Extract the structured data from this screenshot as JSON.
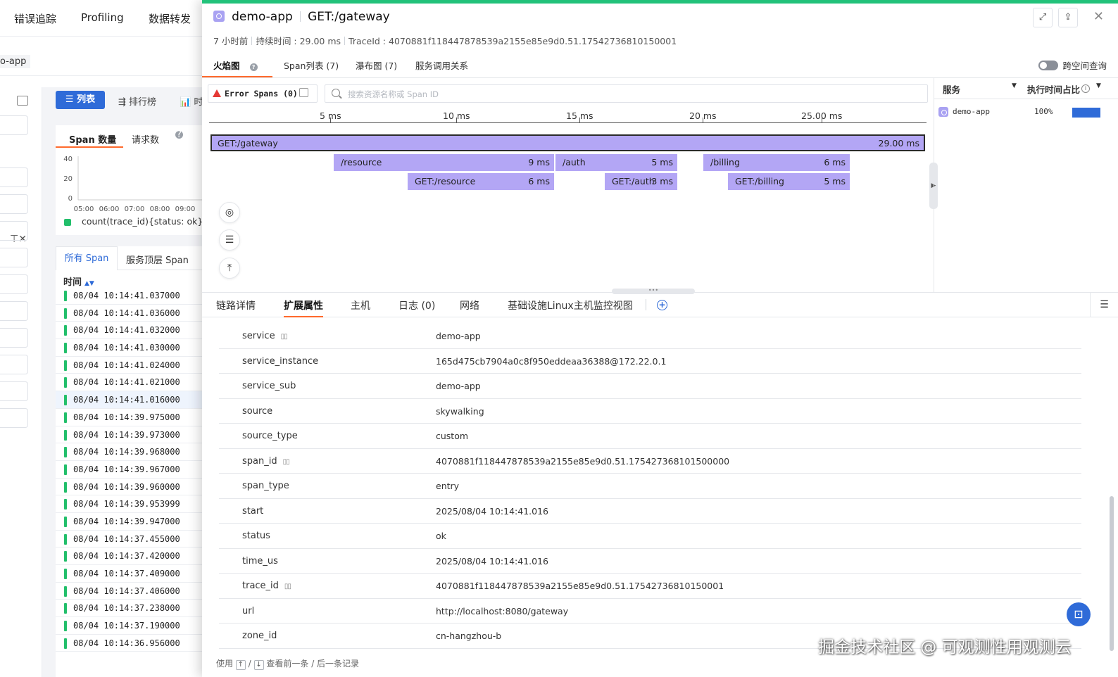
{
  "background_app": {
    "nav_items": [
      "错误追踪",
      "Profiling",
      "数据转发"
    ],
    "app_selector": "o-app",
    "view_buttons": {
      "list": "列表",
      "rank": "排行榜",
      "time": "时"
    },
    "chart_tabs": {
      "span_count": "Span 数量",
      "request_count": "请求数"
    },
    "span_tabs": {
      "all": "所有 Span",
      "top": "服务顶层 Span"
    },
    "time_header": "时间",
    "times": [
      "08/04 10:14:41.037000",
      "08/04 10:14:41.036000",
      "08/04 10:14:41.032000",
      "08/04 10:14:41.030000",
      "08/04 10:14:41.024000",
      "08/04 10:14:41.021000",
      "08/04 10:14:41.016000",
      "08/04 10:14:39.975000",
      "08/04 10:14:39.973000",
      "08/04 10:14:39.968000",
      "08/04 10:14:39.967000",
      "08/04 10:14:39.960000",
      "08/04 10:14:39.953999",
      "08/04 10:14:39.947000",
      "08/04 10:14:37.455000",
      "08/04 10:14:37.420000",
      "08/04 10:14:37.409000",
      "08/04 10:14:37.406000",
      "08/04 10:14:37.238000",
      "08/04 10:14:37.190000",
      "08/04 10:14:36.956000"
    ],
    "selected_index": 6,
    "mini_chart": {
      "type": "line",
      "y_ticks": [
        "40",
        "20",
        "0"
      ],
      "x_ticks": [
        "05:00",
        "06:00",
        "07:00",
        "08:00",
        "09:00"
      ],
      "legend": "count(trace_id){status: ok}",
      "legend_color": "#22bf6b"
    }
  },
  "drawer": {
    "service": "demo-app",
    "operation": "GET:/gateway",
    "meta": {
      "age": "7 小时前",
      "duration": "持续时间 : 29.00 ms",
      "trace_id": "TraceId : 4070881f118447878539a2155e85e9d0.51.17542736810150001"
    },
    "tabs": [
      "火焰图",
      "Span列表 (7)",
      "瀑布图 (7)",
      "服务调用关系"
    ],
    "cross_space_label": "跨空间查询",
    "error_spans_label": "Error Spans (0)",
    "search_placeholder": "搜索资源名称或 Span ID",
    "axis_ticks": [
      "5 ms",
      "10 ms",
      "15 ms",
      "20 ms",
      "25.00 ms"
    ],
    "spans": [
      {
        "name": "GET:/gateway",
        "duration": "29.00 ms",
        "start_ms": 0,
        "dur_ms": 29,
        "level": 0
      },
      {
        "name": "/resource",
        "duration": "9 ms",
        "start_ms": 5,
        "dur_ms": 9,
        "level": 1
      },
      {
        "name": "/auth",
        "duration": "5 ms",
        "start_ms": 14,
        "dur_ms": 5,
        "level": 1
      },
      {
        "name": "/billing",
        "duration": "6 ms",
        "start_ms": 20,
        "dur_ms": 6,
        "level": 1
      },
      {
        "name": "GET:/resource",
        "duration": "6 ms",
        "start_ms": 8,
        "dur_ms": 6,
        "level": 2
      },
      {
        "name": "GET:/auth",
        "duration": "3 ms",
        "start_ms": 16,
        "dur_ms": 3,
        "level": 2
      },
      {
        "name": "GET:/billing",
        "duration": "5 ms",
        "start_ms": 21,
        "dur_ms": 5,
        "level": 2
      }
    ],
    "span_color": "#b3a6f5",
    "service_panel": {
      "col_service": "服务",
      "col_ratio": "执行时间占比",
      "rows": [
        {
          "name": "demo-app",
          "percent": "100%",
          "ratio": 1.0
        }
      ]
    },
    "detail_tabs": [
      "链路详情",
      "扩展属性",
      "主机",
      "日志 (0)",
      "网络",
      "基础设施Linux主机监控视图"
    ],
    "attributes": [
      {
        "key": "service",
        "value": "demo-app",
        "has_icon": true
      },
      {
        "key": "service_instance",
        "value": "165d475cb7904a0c8f950eddeaa36388@172.22.0.1",
        "has_icon": false
      },
      {
        "key": "service_sub",
        "value": "demo-app",
        "has_icon": false
      },
      {
        "key": "source",
        "value": "skywalking",
        "has_icon": false
      },
      {
        "key": "source_type",
        "value": "custom",
        "has_icon": false
      },
      {
        "key": "span_id",
        "value": "4070881f118447878539a2155e85e9d0.51.175427368101500000",
        "has_icon": true
      },
      {
        "key": "span_type",
        "value": "entry",
        "has_icon": false
      },
      {
        "key": "start",
        "value": "2025/08/04 10:14:41.016",
        "has_icon": false
      },
      {
        "key": "status",
        "value": "ok",
        "has_icon": false
      },
      {
        "key": "time_us",
        "value": "2025/08/04 10:14:41.016",
        "has_icon": false
      },
      {
        "key": "trace_id",
        "value": "4070881f118447878539a2155e85e9d0.51.17542736810150001",
        "has_icon": true
      },
      {
        "key": "url",
        "value": "http://localhost:8080/gateway",
        "has_icon": false
      },
      {
        "key": "zone_id",
        "value": "cn-hangzhou-b",
        "has_icon": false
      }
    ],
    "footer": {
      "use": "使用",
      "up_key": "↑",
      "slash": "/",
      "down_key": "↓",
      "hint": "查看前一条 / 后一条记录"
    }
  },
  "watermark": "掘金技术社区 @ 可观测性用观测云"
}
